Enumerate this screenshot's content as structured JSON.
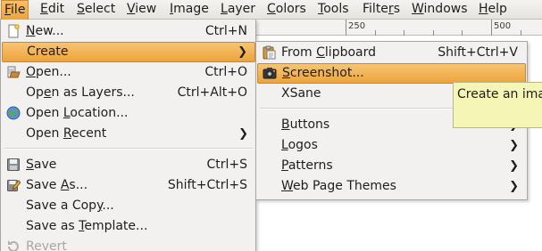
{
  "menubar": {
    "items": [
      {
        "label": "File",
        "mnemonic": "F"
      },
      {
        "label": "Edit",
        "mnemonic": "E"
      },
      {
        "label": "Select",
        "mnemonic": "S"
      },
      {
        "label": "View",
        "mnemonic": "V"
      },
      {
        "label": "Image",
        "mnemonic": "I"
      },
      {
        "label": "Layer",
        "mnemonic": "L"
      },
      {
        "label": "Colors",
        "mnemonic": "C"
      },
      {
        "label": "Tools",
        "mnemonic": "T"
      },
      {
        "label": "Filters",
        "mnemonic": "r"
      },
      {
        "label": "Windows",
        "mnemonic": "W"
      },
      {
        "label": "Help",
        "mnemonic": "H"
      }
    ],
    "active": "File"
  },
  "ruler": {
    "labels": [
      "250",
      "500"
    ]
  },
  "file_menu": {
    "items": [
      {
        "label": "New...",
        "mnemonic": "N",
        "accel": "Ctrl+N",
        "icon": "new-file-icon"
      },
      {
        "label": "Create",
        "mnemonic": "",
        "accel": "",
        "icon": "",
        "submenu": true,
        "highlighted": true
      },
      {
        "label": "Open...",
        "mnemonic": "O",
        "accel": "Ctrl+O",
        "icon": "open-file-icon"
      },
      {
        "label": "Open as Layers...",
        "mnemonic": "e",
        "accel": "Ctrl+Alt+O",
        "icon": ""
      },
      {
        "label": "Open Location...",
        "mnemonic": "L",
        "accel": "",
        "icon": "globe-icon"
      },
      {
        "label": "Open Recent",
        "mnemonic": "R",
        "accel": "",
        "icon": "",
        "submenu": true
      },
      {
        "label": "Save",
        "mnemonic": "S",
        "accel": "Ctrl+S",
        "icon": "save-icon"
      },
      {
        "label": "Save As...",
        "mnemonic": "A",
        "accel": "Shift+Ctrl+S",
        "icon": "save-as-icon"
      },
      {
        "label": "Save a Copy...",
        "mnemonic": "y",
        "accel": "",
        "icon": ""
      },
      {
        "label": "Save as Template...",
        "mnemonic": "T",
        "accel": "",
        "icon": ""
      },
      {
        "label": "Revert",
        "mnemonic": "v",
        "accel": "",
        "icon": "revert-icon",
        "disabled": true
      }
    ]
  },
  "create_menu": {
    "items": [
      {
        "label": "From Clipboard",
        "mnemonic": "C",
        "accel": "Shift+Ctrl+V",
        "icon": "clipboard-icon"
      },
      {
        "label": "Screenshot...",
        "mnemonic": "S",
        "accel": "",
        "icon": "camera-icon",
        "highlighted": true
      },
      {
        "label": "XSane",
        "mnemonic": "",
        "accel": "",
        "icon": "",
        "submenu": true
      },
      {
        "label": "Buttons",
        "mnemonic": "B",
        "accel": "",
        "icon": "",
        "submenu": true
      },
      {
        "label": "Logos",
        "mnemonic": "L",
        "accel": "",
        "icon": "",
        "submenu": true
      },
      {
        "label": "Patterns",
        "mnemonic": "P",
        "accel": "",
        "icon": "",
        "submenu": true
      },
      {
        "label": "Web Page Themes",
        "mnemonic": "W",
        "accel": "",
        "icon": "",
        "submenu": true
      }
    ]
  },
  "tooltip": {
    "text": "Create an imag"
  },
  "colors": {
    "highlight_top": "#f8c472",
    "highlight_bottom": "#eda43c",
    "menu_bg": "#f2f1f0",
    "tooltip_bg": "#f5f5b5"
  }
}
